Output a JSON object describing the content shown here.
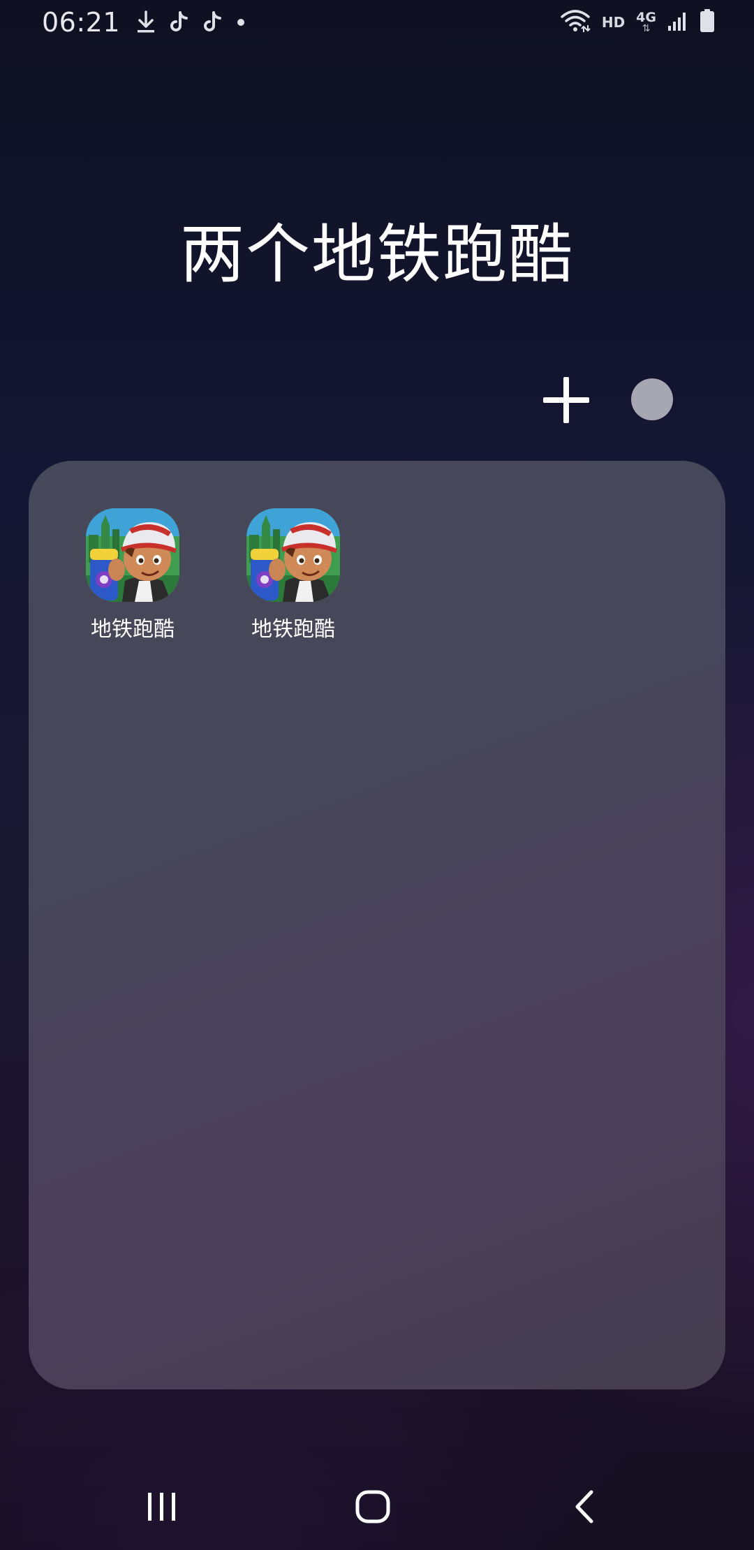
{
  "status_bar": {
    "time": "06:21",
    "left_icons": [
      "download-icon",
      "tiktok-icon",
      "tiktok-icon",
      "notification-dot-icon"
    ],
    "hd_label": "HD",
    "network_label": "4G",
    "right_icons": [
      "wifi-icon",
      "hd-icon",
      "mobile-signal-icon",
      "battery-icon"
    ]
  },
  "folder": {
    "title": "两个地铁跑酷",
    "add_icon": "plus-icon",
    "color_picker_color": "#a7a6b3",
    "apps": [
      {
        "label": "地铁跑酷",
        "icon": "subway-surfers-icon"
      },
      {
        "label": "地铁跑酷",
        "icon": "subway-surfers-icon"
      }
    ]
  },
  "nav_bar": {
    "buttons": [
      "recent-apps-icon",
      "home-icon",
      "back-icon"
    ]
  },
  "colors": {
    "background_top": "#0f1122",
    "background_bottom": "#150f20",
    "folder_panel": "#474859",
    "text": "#ffffff"
  }
}
